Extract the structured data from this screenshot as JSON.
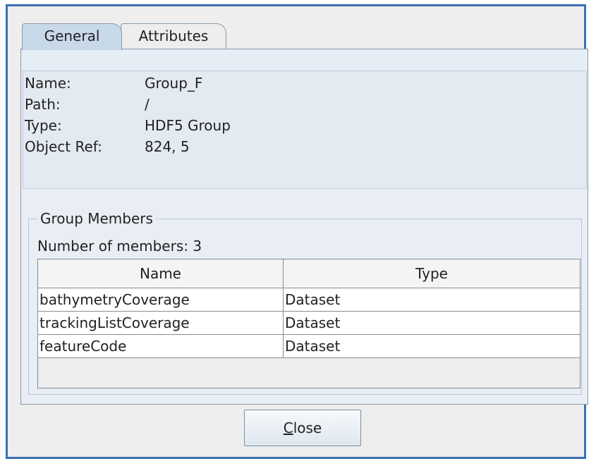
{
  "tabs": [
    {
      "label": "General"
    },
    {
      "label": "Attributes"
    }
  ],
  "info": {
    "name_label": "Name:",
    "name_value": "Group_F",
    "path_label": "Path:",
    "path_value": "/",
    "type_label": "Type:",
    "type_value": "HDF5 Group",
    "objref_label": "Object Ref:",
    "objref_value": "824, 5"
  },
  "group": {
    "title": "Group Members",
    "count_text": "Number of members: 3",
    "columns": [
      "Name",
      "Type"
    ],
    "rows": [
      {
        "name": "bathymetryCoverage",
        "type": "Dataset"
      },
      {
        "name": "trackingListCoverage",
        "type": "Dataset"
      },
      {
        "name": "featureCode",
        "type": "Dataset"
      }
    ]
  },
  "buttons": {
    "close_mnemonic": "C",
    "close_rest": "lose"
  },
  "colors": {
    "window_border": "#3d6fb0",
    "active_tab": "#c8d9ea"
  }
}
